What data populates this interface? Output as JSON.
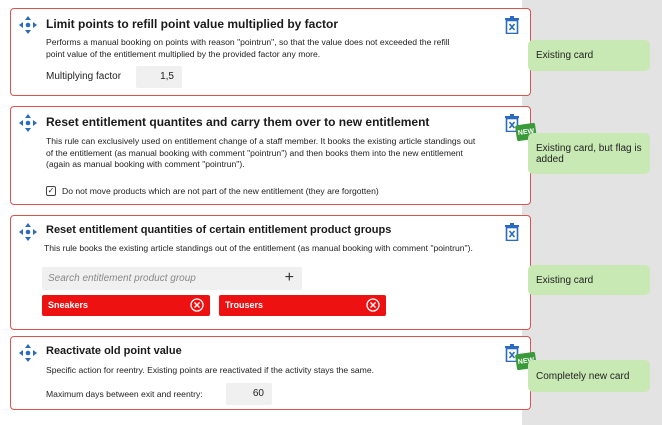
{
  "cards": [
    {
      "title": "Limit points to refill point value multiplied by factor",
      "description": "Performs a manual booking on points with reason \"pointrun\", so that the value does not exceeded the refill point value of the entitlement multiplied by the provided factor any more.",
      "field_label": "Multiplying factor",
      "field_value": "1,5"
    },
    {
      "title": "Reset entitlement quantites and carry them over to new entitlement",
      "description": "This rule can exclusively used on entitlement change of a staff member.  It books the existing article standings out of the entitlement (as manual booking with comment \"pointrun\")  and then books them into the new entitlement (again as manual booking with comment \"pointrun\").",
      "checkbox_label": "Do not move products which are not part of the new entitlement (they are forgotten)",
      "checkbox_checked": "✓",
      "flag": "NEW"
    },
    {
      "title": "Reset entitlement quantities of certain entitlement product groups",
      "description": "This rule books the existing article standings out of the entitlement (as manual booking with comment \"pointrun\").",
      "search_placeholder": "Search entitlement product group",
      "tags": [
        "Sneakers",
        "Trousers"
      ]
    },
    {
      "title": "Reactivate old point value",
      "description": "Specific action for reentry. Existing points are reactivated if the activity stays the same.",
      "field_label": "Maximum days between exit and reentry:",
      "field_value": "60",
      "flag": "NEW"
    }
  ],
  "notes": [
    "Existing card",
    "Existing card, but flag is added",
    "Existing card",
    "Completely new card"
  ],
  "colors": {
    "accent_blue": "#2a6bbf",
    "card_border": "#d9534f",
    "tag_red": "#ee1111",
    "note_green": "#c9e9b4",
    "flag_green": "#3a9a3a"
  },
  "icons": [
    "move-icon",
    "trash-icon",
    "plus-icon",
    "close-circle-icon",
    "checkbox-icon",
    "new-flag-icon"
  ]
}
